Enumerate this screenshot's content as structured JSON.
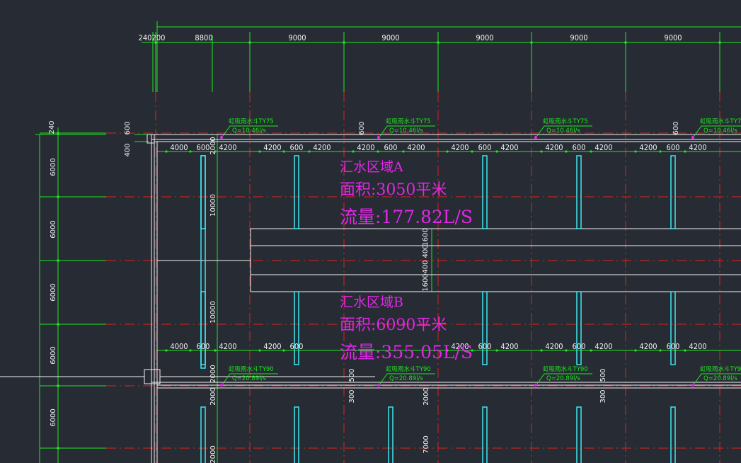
{
  "colors": {
    "background": "#262b34",
    "dimension": "#1eea1e",
    "axis": "#e0231c",
    "wall": "#f2f2f2",
    "gutter": "#3ee8f0",
    "annotation": "#e028e6"
  },
  "top_dimensions": {
    "left_small": "240",
    "left_small2": "200",
    "first": "8800",
    "bays": [
      "9000",
      "9000",
      "9000",
      "9000",
      "9000"
    ]
  },
  "left_dimensions": {
    "top_small": "240",
    "bays": [
      "6000",
      "6000",
      "6000",
      "6000",
      "6000"
    ]
  },
  "small_dims": {
    "d600": "600",
    "d400": "400",
    "d2000": "2000",
    "d10000": "10000",
    "d4000": "4000",
    "d4200": "4200",
    "d1600": "1600",
    "d400b": "400",
    "d300": "300",
    "d500": "500",
    "d7000": "7000"
  },
  "drain_tags": {
    "top_label": "虹吸雨水斗TY75",
    "top_flow": "Q=10.46l/s",
    "bottom_label": "虹吸雨水斗TY90",
    "bottom_flow": "Q=20.89l/s"
  },
  "zone_a": {
    "name": "汇水区域A",
    "area": "面积:3050平米",
    "flow": "流量:177.82L/S"
  },
  "zone_b": {
    "name": "汇水区域B",
    "area": "面积:6090平米",
    "flow": "流量:355.05L/S"
  }
}
